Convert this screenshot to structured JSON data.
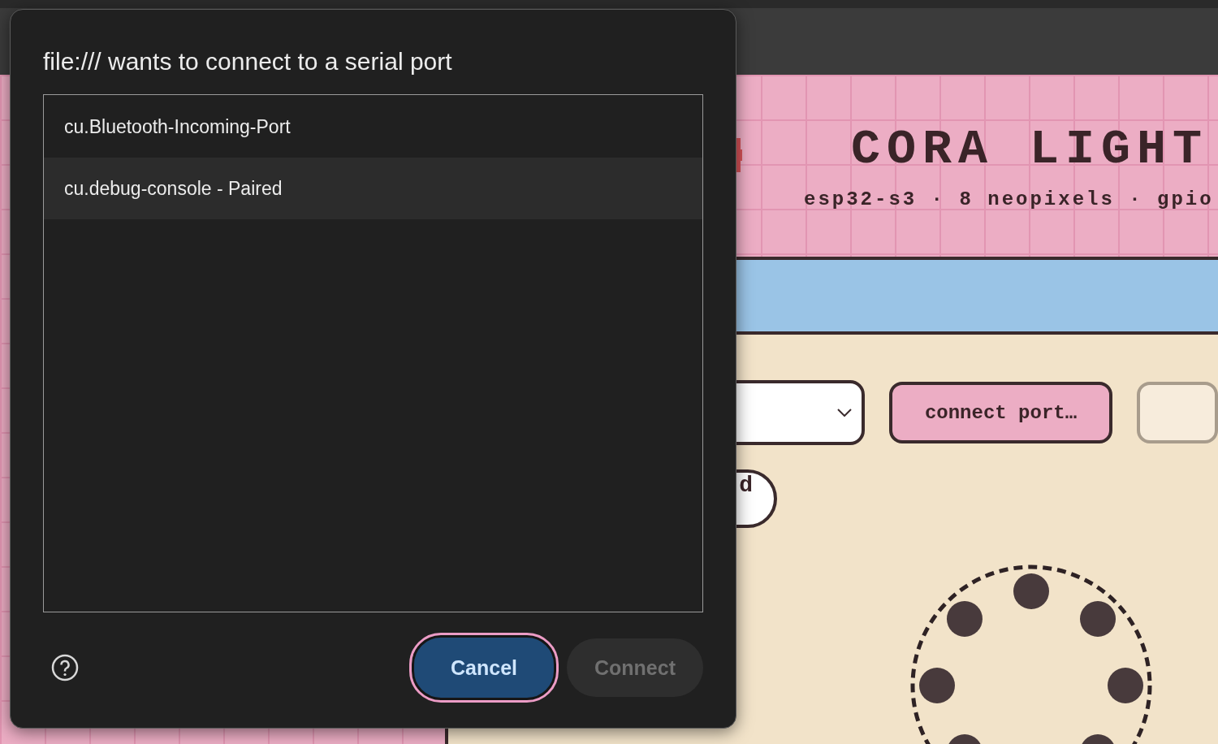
{
  "app": {
    "title": "CORA LIGHT",
    "subtitle": "esp32-s3 · 8 neopixels · gpio",
    "controls": {
      "connect_label": "connect port…",
      "pill_label": "d"
    },
    "leds": [
      {
        "color": "#483a3c"
      },
      {
        "color": "#483a3c"
      },
      {
        "color": "#483a3c"
      },
      {
        "color": "#483a3c"
      },
      {
        "color": "#483a3c"
      },
      {
        "color": "#483a3c"
      },
      {
        "color": "#483a3c"
      }
    ]
  },
  "dialog": {
    "title": "file:/// wants to connect to a serial port",
    "ports": [
      {
        "label": "cu.Bluetooth-Incoming-Port",
        "selected": false
      },
      {
        "label": "cu.debug-console - Paired",
        "selected": true
      }
    ],
    "buttons": [
      {
        "label": "Cancel",
        "kind": "primary",
        "disabled": false
      },
      {
        "label": "Connect",
        "kind": "secondary",
        "disabled": true
      }
    ]
  }
}
